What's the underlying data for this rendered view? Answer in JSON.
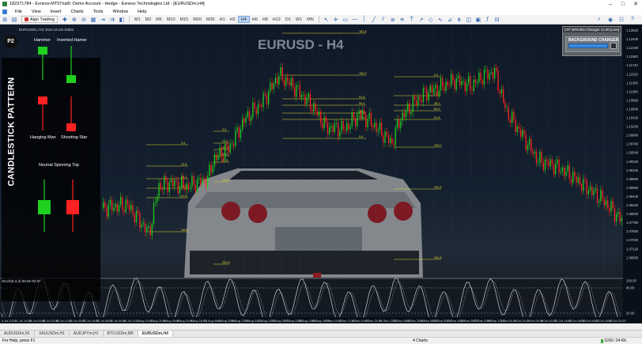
{
  "window": {
    "title": "182371784 - Exness-MT5Trial6: Demo Account - Hedge - Exness Technologies Ltd - [EURUSDm,H4]"
  },
  "menu": [
    "File",
    "View",
    "Insert",
    "Charts",
    "Tools",
    "Window",
    "Help"
  ],
  "toolbar": {
    "algo_label": "Algo Trading",
    "timeframes": [
      "M1",
      "M2",
      "M3",
      "M5",
      "M10",
      "M15",
      "M20",
      "M30",
      "H1",
      "H2",
      "H3",
      "H4",
      "H6",
      "H8",
      "H12",
      "D1",
      "W1",
      "MN"
    ],
    "active_tf": "H4"
  },
  "chart": {
    "symbol_line": "EURUSDm, H4: Euro vs US Dollar",
    "watermark": "EURUSD - H4",
    "vertical_title": "CANDLESTICK PATTERN",
    "badge": "P2",
    "patterns": {
      "hammer": "Hammer",
      "inverted_hammer": "Inverted Hamer",
      "hanging_man": "Hanging Man",
      "shooting_star": "Shooting Star",
      "neutral_spinning_top": "Neutral Spinning Top"
    },
    "plugin": {
      "header": "LTF MT5-BG-Changer v1.00 [Live]",
      "title": "BACKGROUND CHANGER"
    },
    "price_axis": [
      "1.12620",
      "1.12400",
      "1.12180",
      "1.11960",
      "1.11740",
      "1.11520",
      "1.11300",
      "1.11080",
      "1.10860",
      "1.10640",
      "1.10420",
      "1.10200",
      "1.09980",
      "1.09760",
      "1.09540",
      "1.09320",
      "1.09100",
      "1.08880",
      "1.08660",
      "1.08440",
      "1.08220",
      "1.08000",
      "1.07780",
      "1.07560",
      "1.07340",
      "1.07120",
      "1.06900"
    ],
    "fib_labels": [
      "0.0",
      "23.6",
      "38.2",
      "50.0",
      "61.8",
      "100.0",
      "161.8",
      "261.8"
    ],
    "colors": {
      "bull": "#1fd01f",
      "bear": "#ff2222",
      "fib": "#e2d82e"
    }
  },
  "stoch": {
    "label": "Stoch(5,3,3) 96.65 83.97",
    "levels": [
      "100.00",
      "80.00",
      "20.00",
      "0.00"
    ]
  },
  "time_axis": [
    "9 Jul 2024",
    "11 Jul 16:00",
    "15 Jul 04:00",
    "16 Jul 20:00",
    "18 Jul 12:00",
    "22 Jul 00:00",
    "23 Jul 16:00",
    "25 Jul 08:00",
    "29 Jul 00:00",
    "30 Jul 12:00",
    "1 Aug 04:00",
    "2 Aug 20:00",
    "6 Aug 08:00",
    "8 Aug 00:00",
    "9 Aug 16:00",
    "13 Aug 08:00",
    "14 Aug 20:00",
    "16 Aug 12:00",
    "20 Aug 04:00",
    "21 Aug 20:00",
    "23 Aug 08:00",
    "27 Aug 00:00",
    "28 Aug 16:00",
    "30 Aug 04:00",
    "3 Sep 04:00",
    "4 Sep 12:00",
    "6 Sep 04:00",
    "9 Sep 20:00",
    "11 Sep 12:00",
    "13 Sep 04:00",
    "16 Sep 20:00",
    "18 Sep 08:00",
    "20 Sep 00:00",
    "23 Sep 16:00",
    "25 Sep 08:00",
    "27 Sep 00:00",
    "30 Sep 12:00",
    "2 Oct 04:00",
    "3 Oct 20:00",
    "7 Oct 08:00",
    "9 Oct 00:00",
    "10 Oct 16:00",
    "14 Oct 08:00",
    "16 Oct 00:00",
    "17 Oct 16:00",
    "21 Oct 20:00"
  ],
  "tabs": [
    "AUDUSDm,H1",
    "XAUUSDm,H1",
    "AUDJPYm,H1",
    "BTCUSDm,M5",
    "EURUSDm,H4"
  ],
  "active_tab": "EURUSDm,H4",
  "status": {
    "help": "For Help, press F1",
    "charts": "4 Charts",
    "traffic": "1169 / 24 Kb"
  }
}
